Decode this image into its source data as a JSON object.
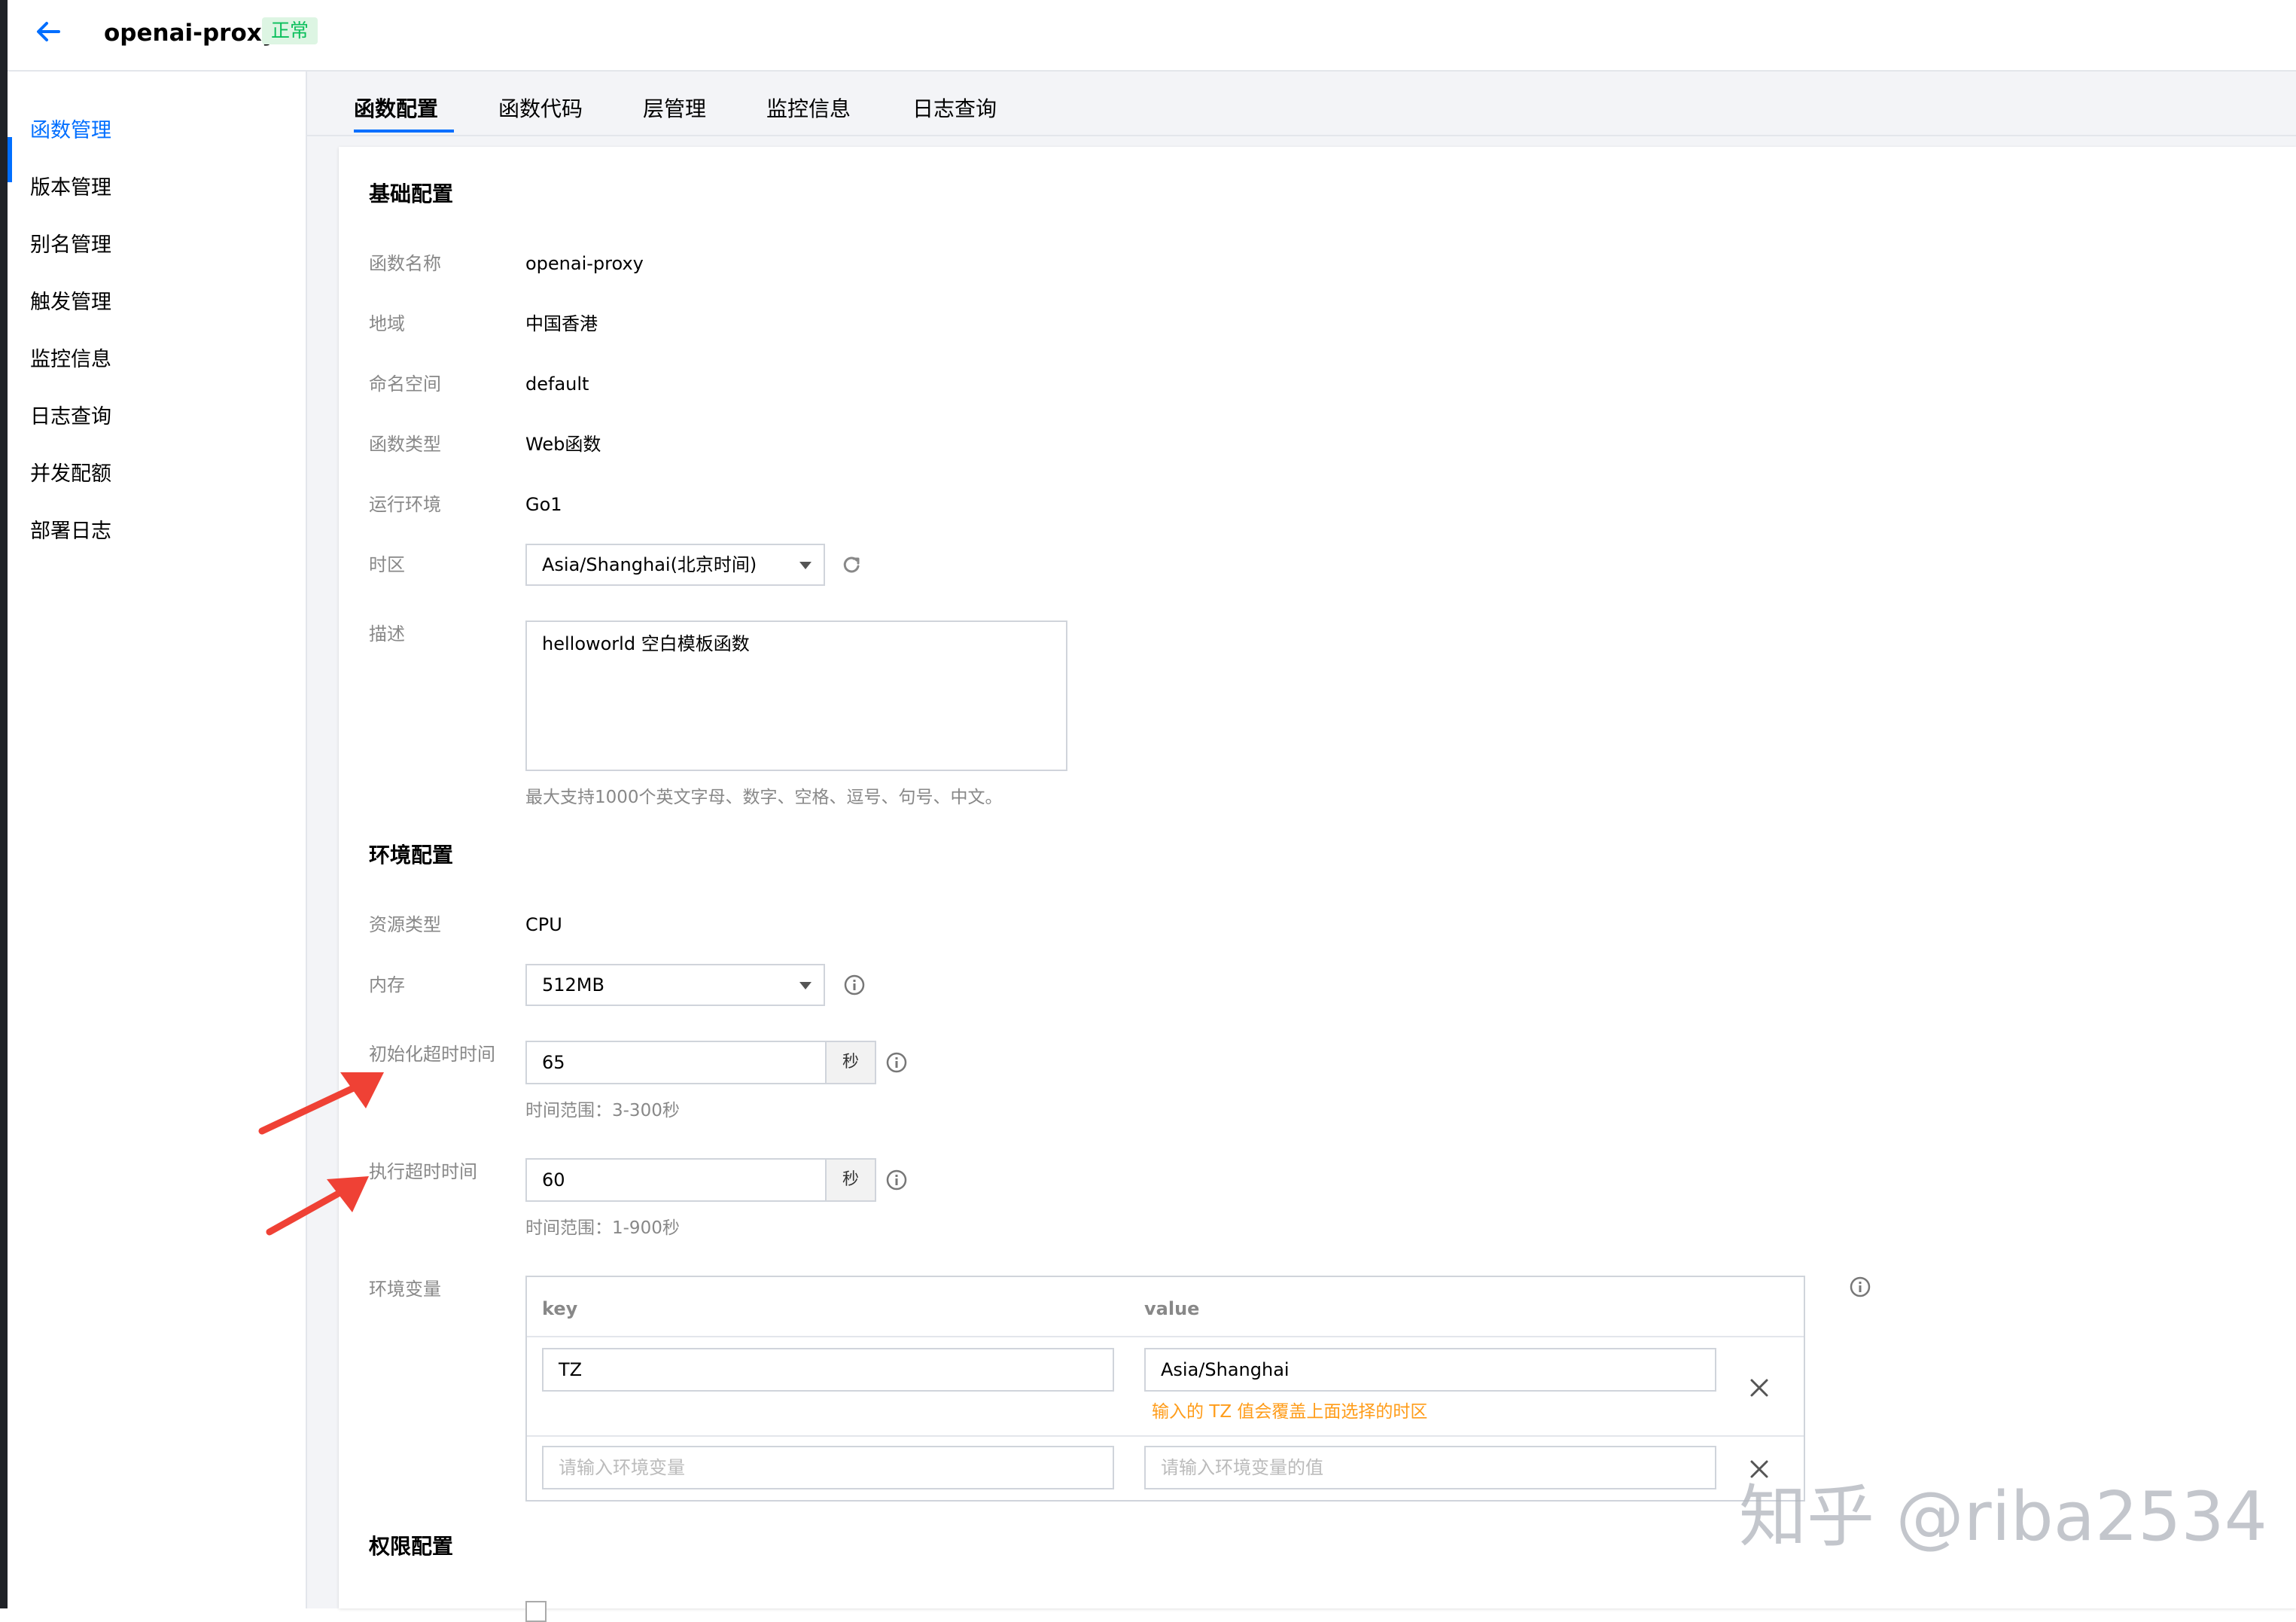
{
  "header": {
    "title": "openai-proxy",
    "status": "正常"
  },
  "sidebar": {
    "items": [
      {
        "label": "函数管理"
      },
      {
        "label": "版本管理"
      },
      {
        "label": "别名管理"
      },
      {
        "label": "触发管理"
      },
      {
        "label": "监控信息"
      },
      {
        "label": "日志查询"
      },
      {
        "label": "并发配额"
      },
      {
        "label": "部署日志"
      }
    ]
  },
  "tabs": [
    "函数配置",
    "函数代码",
    "层管理",
    "监控信息",
    "日志查询"
  ],
  "basic": {
    "title": "基础配置",
    "name_label": "函数名称",
    "name": "openai-proxy",
    "region_label": "地域",
    "region": "中国香港",
    "namespace_label": "命名空间",
    "namespace": "default",
    "type_label": "函数类型",
    "type": "Web函数",
    "runtime_label": "运行环境",
    "runtime": "Go1",
    "timezone_label": "时区",
    "timezone": "Asia/Shanghai(北京时间)",
    "desc_label": "描述",
    "desc": "helloworld 空白模板函数",
    "desc_hint": "最大支持1000个英文字母、数字、空格、逗号、句号、中文。"
  },
  "env": {
    "title": "环境配置",
    "resource_label": "资源类型",
    "resource": "CPU",
    "memory_label": "内存",
    "memory": "512MB",
    "init_timeout_label": "初始化超时时间",
    "init_timeout": "65",
    "init_unit": "秒",
    "init_hint": "时间范围：3-300秒",
    "exec_timeout_label": "执行超时时间",
    "exec_timeout": "60",
    "exec_unit": "秒",
    "exec_hint": "时间范围：1-900秒",
    "vars_label": "环境变量",
    "key_header": "key",
    "value_header": "value",
    "row1_key": "TZ",
    "row1_value": "Asia/Shanghai",
    "row1_warn": "输入的 TZ 值会覆盖上面选择的时区",
    "key_placeholder": "请输入环境变量",
    "value_placeholder": "请输入环境变量的值"
  },
  "permission": {
    "title": "权限配置"
  },
  "watermark": "知乎 @riba2534",
  "colors": {
    "accent": "#006eff",
    "success": "#0abf5b",
    "warning": "#ff9c19",
    "arrow": "#ef4135"
  }
}
